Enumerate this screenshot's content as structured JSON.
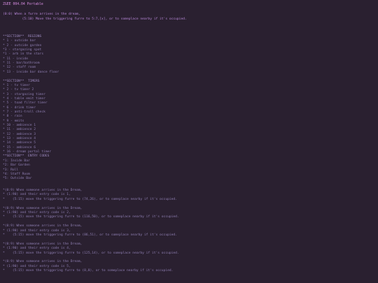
{
  "title": "ZGEE 004.04 Portable",
  "header_lines": [
    {
      "text": "(0:0) When a furre arrives in the dream,",
      "class": "code"
    },
    {
      "text": "          (5:10) Move the triggering furre to 5:7,[x], or to someplace nearby if it's occupied.",
      "class": "code"
    }
  ],
  "sections": [
    {
      "text": "**SECTION**  REGIONS",
      "class": "section"
    },
    {
      "text": "* 1 - outside bar",
      "class": "comment"
    },
    {
      "text": "* 2 - outside garden",
      "class": "comment"
    },
    {
      "text": "*3 - stargazing spot",
      "class": "comment"
    },
    {
      "text": "*1 - arb in the stars",
      "class": "comment"
    },
    {
      "text": "* 11 - inside",
      "class": "comment"
    },
    {
      "text": "* 11 - bar/bathroom",
      "class": "comment"
    },
    {
      "text": "* 12 - staff room",
      "class": "comment"
    },
    {
      "text": "* 13 - inside bar dance floor",
      "class": "comment"
    },
    {
      "text": "",
      "class": "comment"
    },
    {
      "text": "**SECTION**  TIMERS",
      "class": "section"
    },
    {
      "text": "* 1 - tv timer",
      "class": "comment"
    },
    {
      "text": "* 2 - tv timer 2",
      "class": "comment"
    },
    {
      "text": "* 3 - stargazing timer",
      "class": "comment"
    },
    {
      "text": "* 4 - table emit timer",
      "class": "comment"
    },
    {
      "text": "* 5 - toad filter timer",
      "class": "comment"
    },
    {
      "text": "* 6 - drink timer",
      "class": "comment"
    },
    {
      "text": "* 7 - anti-troll check",
      "class": "comment"
    },
    {
      "text": "* 8 - rain",
      "class": "comment"
    },
    {
      "text": "* 9 - emits",
      "class": "comment"
    },
    {
      "text": "* 10 - ambience 1",
      "class": "comment"
    },
    {
      "text": "* 11 - ambience 2",
      "class": "comment"
    },
    {
      "text": "* 12 - ambience 3",
      "class": "comment"
    },
    {
      "text": "* 13 - ambience 4",
      "class": "comment"
    },
    {
      "text": "* 14 - ambience 5",
      "class": "comment"
    },
    {
      "text": "* 15 - ambience 6",
      "class": "comment"
    },
    {
      "text": "* 16 - dream portal timer",
      "class": "comment"
    },
    {
      "text": "**SECTION**  ENTRY CODES",
      "class": "section"
    },
    {
      "text": "*1: Inside Bar",
      "class": "comment"
    },
    {
      "text": "*2: Bar Garden",
      "class": "comment"
    },
    {
      "text": "*3: Roll",
      "class": "comment"
    },
    {
      "text": "*4: Staff Room",
      "class": "comment"
    },
    {
      "text": "*5: Outside Bar",
      "class": "comment"
    }
  ],
  "entries": [
    [
      "*(0:9) When someone arrives in the Dream,",
      "* (1:90) and their entry code is 1,",
      "*    (5:15) move the triggering furre to (74,26), or to someplace nearby if it's occupied."
    ],
    [
      "*(0:9) When someone arrives in the Dream,",
      "* (1:90) and their entry code is 2,",
      "*    (5:15) move the triggering furre to (116,50), or to someplace nearby if it's occupied."
    ],
    [
      "*(0:9) When someone arrives in the Dream,",
      "* (1:90) and their entry code is 3,",
      "*    (5:15) move the triggering furre to (86,51), or to someplace nearby if it's occupied."
    ],
    [
      "*(0:9) When someone arrives in the Dream,",
      "* (1:90) and their entry code is 4,",
      "*    (5:15) move the triggering furre to (125,14), or to someplace nearby if it's occupied."
    ],
    [
      "*(0:9) When someone arrives in the Dream,",
      "* (1:90) and their entry code is 5,",
      "*    (5:15) move the triggering furre to (8,8), or to someplace nearby if it's occupied."
    ]
  ]
}
